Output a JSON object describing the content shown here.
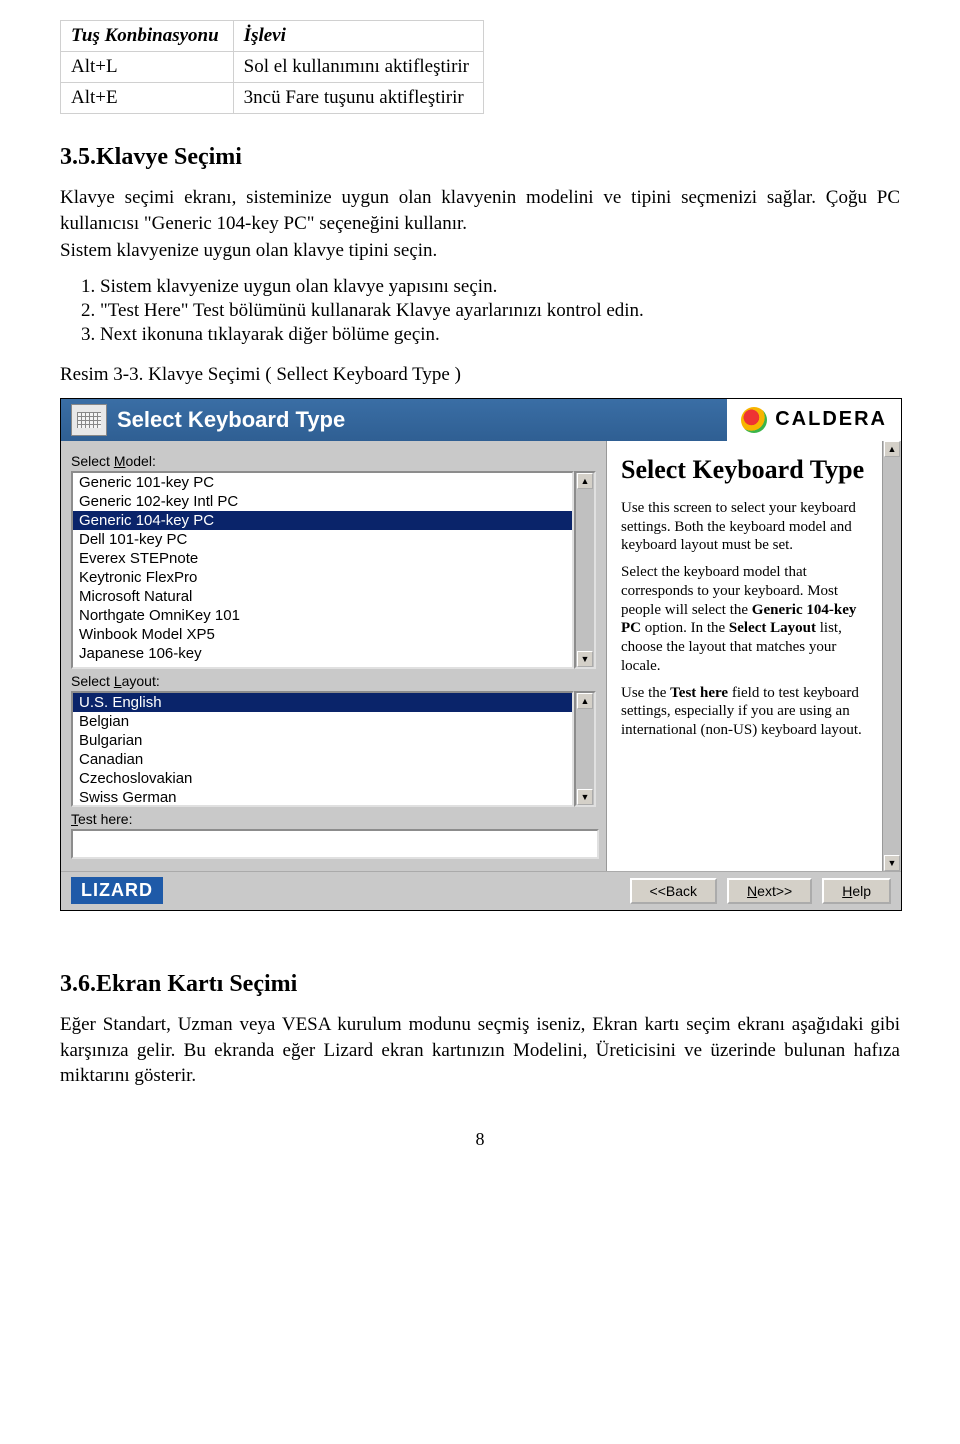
{
  "keytable": {
    "head_combo": "Tuş Konbinasyonu",
    "head_func": "İşlevi",
    "rows": [
      {
        "combo": "Alt+L",
        "func": "Sol el kullanımını aktifleştirir"
      },
      {
        "combo": "Alt+E",
        "func": "3ncü Fare tuşunu aktifleştirir"
      }
    ]
  },
  "section1": {
    "heading": "3.5.Klavye Seçimi",
    "para": "Klavye seçimi ekranı, sisteminize uygun olan klavyenin modelini ve tipini seçmenizi sağlar. Çoğu PC kullanıcısı \"Generic 104-key PC\" seçeneğini kullanır.",
    "para2": "Sistem klavyenize uygun olan klavye tipini seçin.",
    "steps": [
      "Sistem klavyenize uygun olan klavye yapısını seçin.",
      "\"Test Here\" Test bölümünü kullanarak Klavye ayarlarınızı kontrol edin.",
      "Next ikonuna tıklayarak diğer bölüme geçin."
    ],
    "figcap": "Resim 3-3. Klavye Seçimi ( Sellect Keyboard Type )"
  },
  "shot": {
    "title": "Select Keyboard Type",
    "logo": "CALDERA",
    "label_model_pre": "Select ",
    "label_model_u": "M",
    "label_model_post": "odel:",
    "models": [
      "Generic 101-key PC",
      "Generic 102-key Intl PC",
      "Generic 104-key PC",
      "Dell 101-key PC",
      "Everex STEPnote",
      "Keytronic FlexPro",
      "Microsoft Natural",
      "Northgate OmniKey 101",
      "Winbook Model XP5",
      "Japanese 106-key"
    ],
    "model_selected_index": 2,
    "label_layout_pre": "Select ",
    "label_layout_u": "L",
    "label_layout_post": "ayout:",
    "layouts": [
      "U.S. English",
      "Belgian",
      "Bulgarian",
      "Canadian",
      "Czechoslovakian",
      "Swiss German"
    ],
    "layout_selected_index": 0,
    "label_test_u": "T",
    "label_test_post": "est here:",
    "help_title": "Select Keyboard Type",
    "help_p1": "Use this screen to select your keyboard settings. Both the keyboard model and keyboard layout must be set.",
    "help_p2_a": "Select the keyboard model that corresponds to your keyboard. Most people will select the ",
    "help_p2_b": "Generic 104-key PC",
    "help_p2_c": " option. In the ",
    "help_p2_d": "Select Layout",
    "help_p2_e": " list, choose the layout that matches your locale.",
    "help_p3_a": "Use the ",
    "help_p3_b": "Test here",
    "help_p3_c": " field to test keyboard settings, especially if you are using an international (non-US) keyboard layout.",
    "footer_brand": "LIZARD",
    "btn_back": "<<Back",
    "btn_next_u": "N",
    "btn_next_post": "ext>>",
    "btn_help_u": "H",
    "btn_help_post": "elp"
  },
  "section2": {
    "heading": "3.6.Ekran Kartı Seçimi",
    "para": "Eğer Standart, Uzman veya VESA kurulum modunu seçmiş iseniz, Ekran kartı seçim ekranı aşağıdaki gibi karşınıza gelir. Bu ekranda eğer Lizard ekran kartınızın Modelini, Üreticisini ve üzerinde bulunan hafıza miktarını gösterir."
  },
  "pagenum": "8"
}
